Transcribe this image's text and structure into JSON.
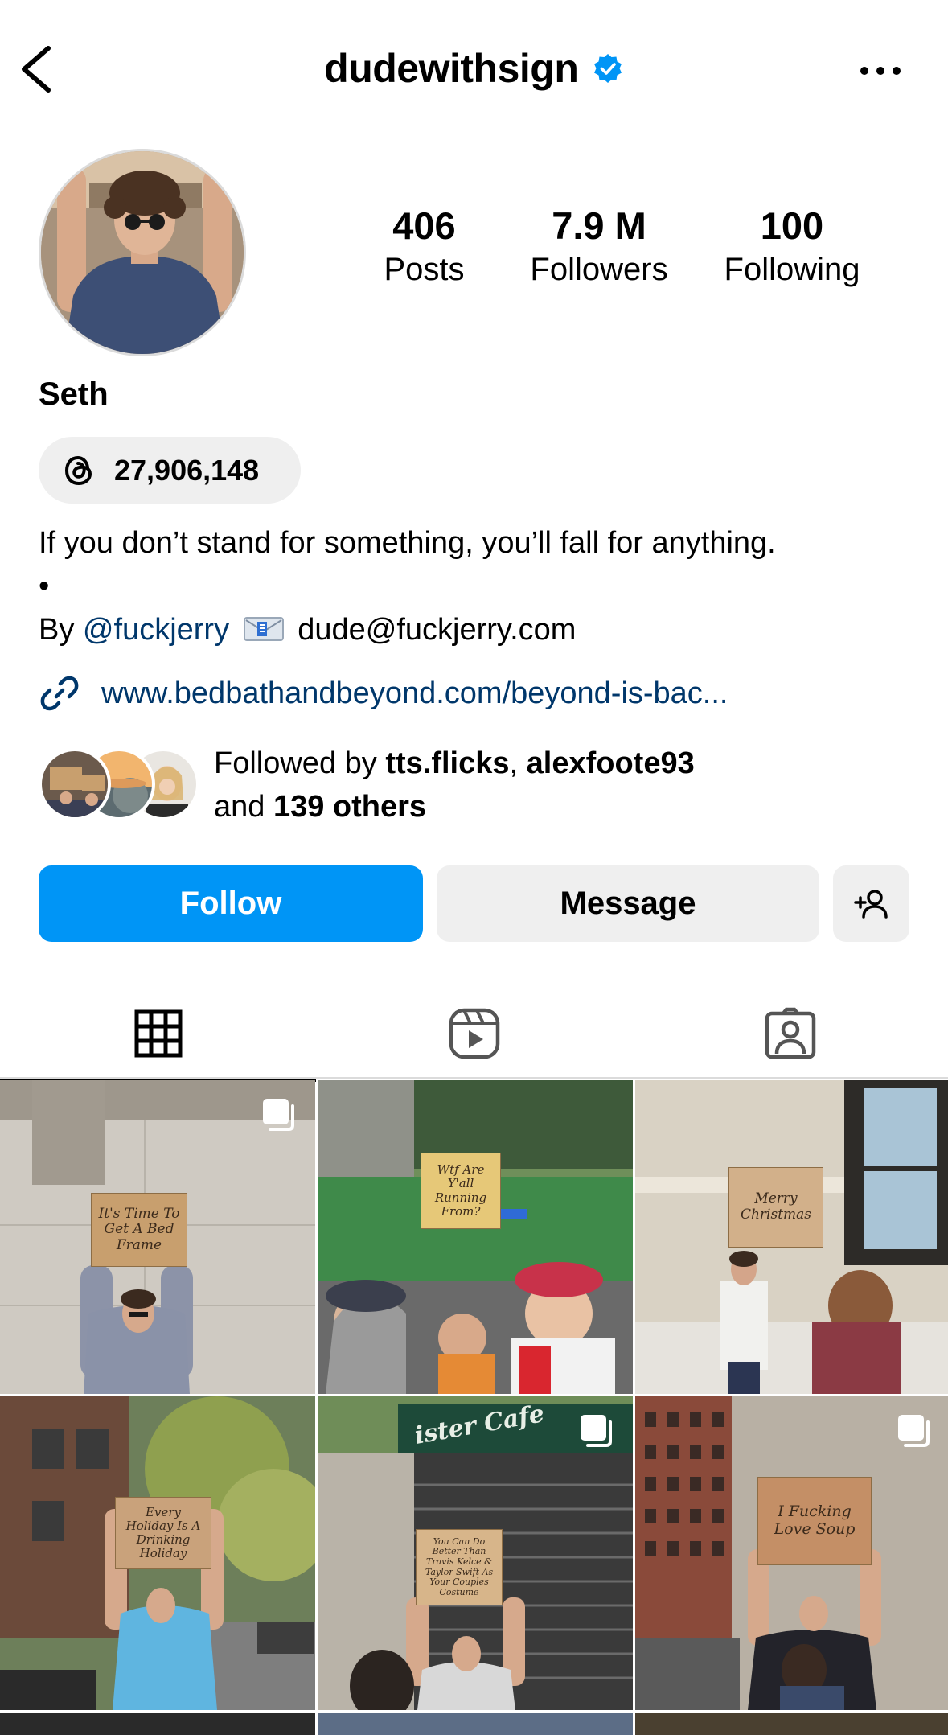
{
  "header": {
    "username": "dudewithsign",
    "verified_icon": "verified-badge-icon",
    "back_icon": "chevron-left-icon",
    "more_icon": "more-horizontal-icon"
  },
  "stats": [
    {
      "value": "406",
      "label": "Posts"
    },
    {
      "value": "7.9 M",
      "label": "Followers"
    },
    {
      "value": "100",
      "label": "Following"
    }
  ],
  "profile": {
    "name": "Seth",
    "threads_count": "27,906,148",
    "bio_line1": "If you don’t stand for something, you’ll fall for anything.",
    "bio_line2": "•",
    "bio_by": "By",
    "bio_handle": "@fuckjerry",
    "bio_email": "dude@fuckjerry.com",
    "link": "www.bedbathandbeyond.com/beyond-is-bac..."
  },
  "followed_by": {
    "prefix": "Followed by",
    "user1": "tts.flicks",
    "separator": ",",
    "user2": "alexfoote93",
    "and": "and",
    "others": "139 others"
  },
  "actions": {
    "follow": "Follow",
    "message": "Message",
    "add_user_icon": "add-person-icon"
  },
  "tabs": [
    "grid-icon",
    "reels-icon",
    "tagged-icon"
  ],
  "posts": [
    {
      "sign": "It's Time To Get A Bed Frame",
      "multi": true
    },
    {
      "sign": "Wtf Are Y'all Running From?",
      "multi": false
    },
    {
      "sign": "Merry Christmas",
      "multi": false
    },
    {
      "sign": "Every Holiday Is A Drinking Holiday",
      "multi": false
    },
    {
      "sign": "You Can Do Better Than Travis Kelce & Taylor Swift As Your Couples Costume",
      "multi": true,
      "storefront": "ister Cafe"
    },
    {
      "sign": "I Fucking Love Soup",
      "multi": true
    }
  ],
  "colors": {
    "follow_button": "#0095f6",
    "link": "#00376b",
    "verified": "#0095f6",
    "secondary_button": "#efefef"
  }
}
